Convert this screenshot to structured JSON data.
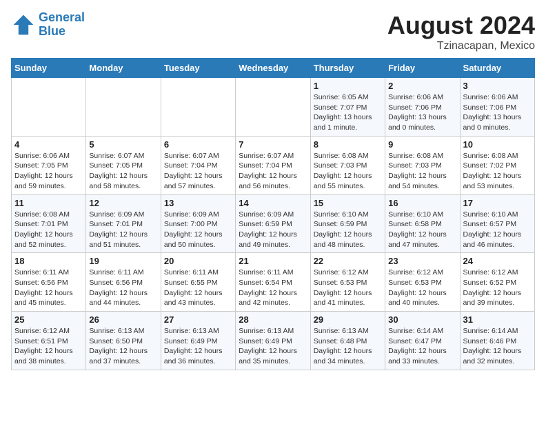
{
  "header": {
    "logo_line1": "General",
    "logo_line2": "Blue",
    "month": "August 2024",
    "location": "Tzinacapan, Mexico"
  },
  "days_of_week": [
    "Sunday",
    "Monday",
    "Tuesday",
    "Wednesday",
    "Thursday",
    "Friday",
    "Saturday"
  ],
  "weeks": [
    [
      {
        "day": "",
        "detail": ""
      },
      {
        "day": "",
        "detail": ""
      },
      {
        "day": "",
        "detail": ""
      },
      {
        "day": "",
        "detail": ""
      },
      {
        "day": "1",
        "detail": "Sunrise: 6:05 AM\nSunset: 7:07 PM\nDaylight: 13 hours\nand 1 minute."
      },
      {
        "day": "2",
        "detail": "Sunrise: 6:06 AM\nSunset: 7:06 PM\nDaylight: 13 hours\nand 0 minutes."
      },
      {
        "day": "3",
        "detail": "Sunrise: 6:06 AM\nSunset: 7:06 PM\nDaylight: 13 hours\nand 0 minutes."
      }
    ],
    [
      {
        "day": "4",
        "detail": "Sunrise: 6:06 AM\nSunset: 7:05 PM\nDaylight: 12 hours\nand 59 minutes."
      },
      {
        "day": "5",
        "detail": "Sunrise: 6:07 AM\nSunset: 7:05 PM\nDaylight: 12 hours\nand 58 minutes."
      },
      {
        "day": "6",
        "detail": "Sunrise: 6:07 AM\nSunset: 7:04 PM\nDaylight: 12 hours\nand 57 minutes."
      },
      {
        "day": "7",
        "detail": "Sunrise: 6:07 AM\nSunset: 7:04 PM\nDaylight: 12 hours\nand 56 minutes."
      },
      {
        "day": "8",
        "detail": "Sunrise: 6:08 AM\nSunset: 7:03 PM\nDaylight: 12 hours\nand 55 minutes."
      },
      {
        "day": "9",
        "detail": "Sunrise: 6:08 AM\nSunset: 7:03 PM\nDaylight: 12 hours\nand 54 minutes."
      },
      {
        "day": "10",
        "detail": "Sunrise: 6:08 AM\nSunset: 7:02 PM\nDaylight: 12 hours\nand 53 minutes."
      }
    ],
    [
      {
        "day": "11",
        "detail": "Sunrise: 6:08 AM\nSunset: 7:01 PM\nDaylight: 12 hours\nand 52 minutes."
      },
      {
        "day": "12",
        "detail": "Sunrise: 6:09 AM\nSunset: 7:01 PM\nDaylight: 12 hours\nand 51 minutes."
      },
      {
        "day": "13",
        "detail": "Sunrise: 6:09 AM\nSunset: 7:00 PM\nDaylight: 12 hours\nand 50 minutes."
      },
      {
        "day": "14",
        "detail": "Sunrise: 6:09 AM\nSunset: 6:59 PM\nDaylight: 12 hours\nand 49 minutes."
      },
      {
        "day": "15",
        "detail": "Sunrise: 6:10 AM\nSunset: 6:59 PM\nDaylight: 12 hours\nand 48 minutes."
      },
      {
        "day": "16",
        "detail": "Sunrise: 6:10 AM\nSunset: 6:58 PM\nDaylight: 12 hours\nand 47 minutes."
      },
      {
        "day": "17",
        "detail": "Sunrise: 6:10 AM\nSunset: 6:57 PM\nDaylight: 12 hours\nand 46 minutes."
      }
    ],
    [
      {
        "day": "18",
        "detail": "Sunrise: 6:11 AM\nSunset: 6:56 PM\nDaylight: 12 hours\nand 45 minutes."
      },
      {
        "day": "19",
        "detail": "Sunrise: 6:11 AM\nSunset: 6:56 PM\nDaylight: 12 hours\nand 44 minutes."
      },
      {
        "day": "20",
        "detail": "Sunrise: 6:11 AM\nSunset: 6:55 PM\nDaylight: 12 hours\nand 43 minutes."
      },
      {
        "day": "21",
        "detail": "Sunrise: 6:11 AM\nSunset: 6:54 PM\nDaylight: 12 hours\nand 42 minutes."
      },
      {
        "day": "22",
        "detail": "Sunrise: 6:12 AM\nSunset: 6:53 PM\nDaylight: 12 hours\nand 41 minutes."
      },
      {
        "day": "23",
        "detail": "Sunrise: 6:12 AM\nSunset: 6:53 PM\nDaylight: 12 hours\nand 40 minutes."
      },
      {
        "day": "24",
        "detail": "Sunrise: 6:12 AM\nSunset: 6:52 PM\nDaylight: 12 hours\nand 39 minutes."
      }
    ],
    [
      {
        "day": "25",
        "detail": "Sunrise: 6:12 AM\nSunset: 6:51 PM\nDaylight: 12 hours\nand 38 minutes."
      },
      {
        "day": "26",
        "detail": "Sunrise: 6:13 AM\nSunset: 6:50 PM\nDaylight: 12 hours\nand 37 minutes."
      },
      {
        "day": "27",
        "detail": "Sunrise: 6:13 AM\nSunset: 6:49 PM\nDaylight: 12 hours\nand 36 minutes."
      },
      {
        "day": "28",
        "detail": "Sunrise: 6:13 AM\nSunset: 6:49 PM\nDaylight: 12 hours\nand 35 minutes."
      },
      {
        "day": "29",
        "detail": "Sunrise: 6:13 AM\nSunset: 6:48 PM\nDaylight: 12 hours\nand 34 minutes."
      },
      {
        "day": "30",
        "detail": "Sunrise: 6:14 AM\nSunset: 6:47 PM\nDaylight: 12 hours\nand 33 minutes."
      },
      {
        "day": "31",
        "detail": "Sunrise: 6:14 AM\nSunset: 6:46 PM\nDaylight: 12 hours\nand 32 minutes."
      }
    ]
  ]
}
